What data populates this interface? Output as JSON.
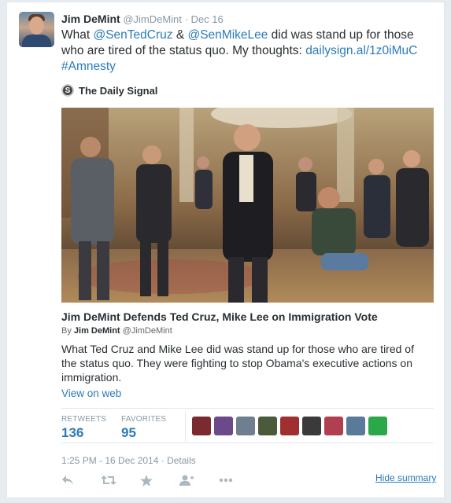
{
  "tweet": {
    "author_name": "Jim DeMint",
    "author_handle": "@JimDeMint",
    "separator": "·",
    "date": "Dec 16",
    "text_parts": {
      "t1": "What ",
      "mention1": "@SenTedCruz",
      "t2": " & ",
      "mention2": "@SenMikeLee",
      "t3": " did was stand up for those who are tired of the status quo. My thoughts: ",
      "url": "dailysign.al/1z0iMuC",
      "t4": " ",
      "hashtag": "#Amnesty"
    }
  },
  "card": {
    "source_logo": "S",
    "source_name": "The Daily Signal",
    "title": "Jim DeMint Defends Ted Cruz, Mike Lee on Immigration Vote",
    "byline_prefix": "By ",
    "byline_name": "Jim DeMint",
    "byline_handle": " @JimDeMint",
    "description": "What Ted Cruz and Mike Lee did was stand up for those who are tired of the status quo. They were fighting to stop Obama's executive actions on immigration.",
    "view_on_web": "View on web"
  },
  "stats": {
    "retweets_label": "RETWEETS",
    "retweets_count": "136",
    "favorites_label": "FAVORITES",
    "favorites_count": "95"
  },
  "favoriter_avatar_colors": [
    "#7a2a30",
    "#6a4a8a",
    "#6f7f8f",
    "#4a5a3a",
    "#a03030",
    "#3a3a3a",
    "#b04050",
    "#5a7a9a",
    "#2aa84a"
  ],
  "timestamp": "1:25 PM - 16 Dec 2014 · Details",
  "actions": {
    "reply_icon": "reply-icon",
    "retweet_icon": "retweet-icon",
    "favorite_icon": "star-icon",
    "follow_icon": "follow-icon",
    "more_icon": "more-icon",
    "hide_summary": "Hide summary"
  },
  "colors": {
    "link": "#2b7bb9",
    "muted": "#8899a6",
    "icon": "#aab8c2"
  }
}
